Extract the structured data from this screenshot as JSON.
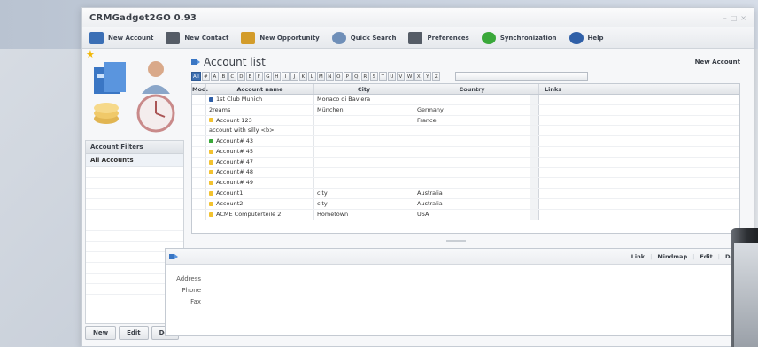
{
  "app": {
    "title": "CRMGadget2GO 0.93"
  },
  "toolbar": [
    {
      "label": "New Account",
      "icon": "new-account-icon",
      "color": "#3b6fb5"
    },
    {
      "label": "New Contact",
      "icon": "new-contact-icon",
      "color": "#555c66"
    },
    {
      "label": "New Opportunity",
      "icon": "new-opportunity-icon",
      "color": "#d39c2a"
    },
    {
      "label": "Quick Search",
      "icon": "search-icon",
      "color": "#6f8fb8"
    },
    {
      "label": "Preferences",
      "icon": "preferences-icon",
      "color": "#555c66"
    },
    {
      "label": "Synchronization",
      "icon": "sync-icon",
      "color": "#3aa83a"
    },
    {
      "label": "Help",
      "icon": "help-icon",
      "color": "#2f5fa7"
    }
  ],
  "filters": {
    "header": "Account Filters",
    "items": [
      "All Accounts"
    ]
  },
  "left_buttons": [
    "New",
    "Edit",
    "Del"
  ],
  "account_list": {
    "title": "Account list",
    "new_label": "New Account",
    "alphabet": [
      "All",
      "#",
      "A",
      "B",
      "C",
      "D",
      "E",
      "F",
      "G",
      "H",
      "I",
      "J",
      "K",
      "L",
      "M",
      "N",
      "O",
      "P",
      "Q",
      "R",
      "S",
      "T",
      "U",
      "V",
      "W",
      "X",
      "Y",
      "Z"
    ],
    "selected_letter": "All",
    "columns": [
      "Mod.",
      "Account name",
      "City",
      "Country",
      "Links"
    ],
    "rows": [
      {
        "mark": "#2f5fa7",
        "name": "1st Club Munich",
        "city": "Monaco di Baviera",
        "country": ""
      },
      {
        "mark": "",
        "name": "2reams",
        "city": "München",
        "country": "Germany"
      },
      {
        "mark": "#f2c230",
        "name": "Account 123",
        "city": "",
        "country": "France"
      },
      {
        "mark": "",
        "name": "account with silly <b>;",
        "city": "",
        "country": ""
      },
      {
        "mark": "#3aa83a",
        "name": "Account# 43",
        "city": "",
        "country": ""
      },
      {
        "mark": "#f2c230",
        "name": "Account# 45",
        "city": "",
        "country": ""
      },
      {
        "mark": "#f2c230",
        "name": "Account# 47",
        "city": "",
        "country": ""
      },
      {
        "mark": "#f2c230",
        "name": "Account# 48",
        "city": "",
        "country": ""
      },
      {
        "mark": "#f2c230",
        "name": "Account# 49",
        "city": "",
        "country": ""
      },
      {
        "mark": "#f2c230",
        "name": "Account1",
        "city": "city",
        "country": "Australia"
      },
      {
        "mark": "#f2c230",
        "name": "Account2",
        "city": "city",
        "country": "Australia"
      },
      {
        "mark": "#f2c230",
        "name": "ACME Computerteile 2",
        "city": "Hometown",
        "country": "USA"
      }
    ]
  },
  "detail": {
    "links": [
      "Link",
      "Mindmap",
      "Edit",
      "Del"
    ],
    "fields": [
      "Address",
      "Phone",
      "Fax"
    ]
  },
  "colors": {
    "accent": "#3d6fb0",
    "star": "#f2b705"
  }
}
